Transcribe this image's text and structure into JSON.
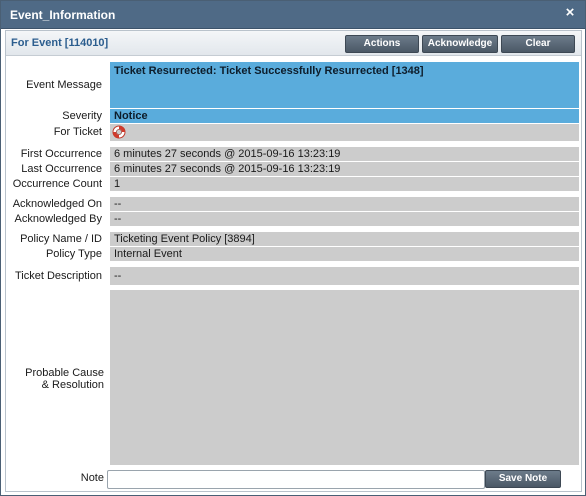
{
  "window": {
    "title": "Event_Information",
    "close_glyph": "×"
  },
  "header": {
    "for_event": "For Event [114010]",
    "buttons": {
      "actions": "Actions",
      "acknowledge": "Acknowledge",
      "clear": "Clear"
    }
  },
  "fields": {
    "event_message": {
      "label": "Event Message",
      "value": "Ticket Resurrected: Ticket Successfully Resurrected [1348]"
    },
    "severity": {
      "label": "Severity",
      "value": "Notice"
    },
    "for_ticket": {
      "label": "For Ticket",
      "icon": "lifebuoy-icon"
    },
    "first_occurrence": {
      "label": "First Occurrence",
      "value": "6 minutes 27 seconds @ 2015-09-16 13:23:19"
    },
    "last_occurrence": {
      "label": "Last Occurrence",
      "value": "6 minutes 27 seconds @ 2015-09-16 13:23:19"
    },
    "occurrence_count": {
      "label": "Occurrence Count",
      "value": "1"
    },
    "acknowledged_on": {
      "label": "Acknowledged On",
      "value": "--"
    },
    "acknowledged_by": {
      "label": "Acknowledged By",
      "value": "--"
    },
    "policy_name": {
      "label": "Policy Name / ID",
      "value": "Ticketing Event Policy [3894]"
    },
    "policy_type": {
      "label": "Policy Type",
      "value": "Internal Event"
    },
    "ticket_description": {
      "label": "Ticket Description",
      "value": "--"
    },
    "probable_cause": {
      "label_line1": "Probable Cause",
      "label_line2": "& Resolution",
      "value": ""
    }
  },
  "note": {
    "label": "Note",
    "value": "",
    "placeholder": "",
    "save_label": "Save Note"
  },
  "colors": {
    "titlebar": "#4f6a86",
    "highlight": "#5aacdc",
    "field_bg": "#cccccc",
    "button": "#56626f"
  }
}
